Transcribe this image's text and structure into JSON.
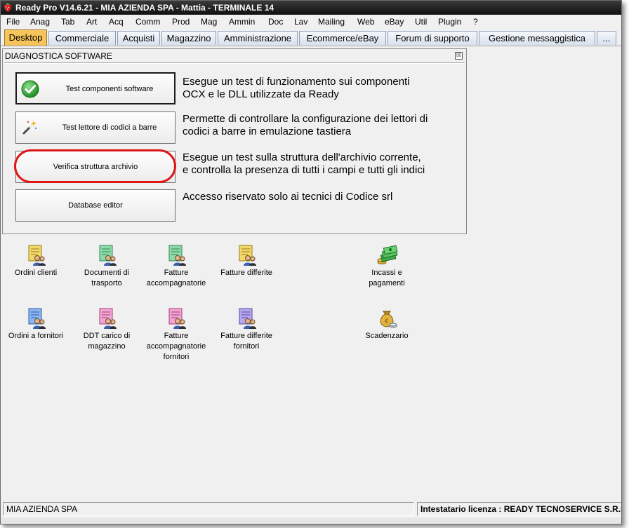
{
  "window": {
    "title": "Ready Pro V14.6.21 - MIA AZIENDA SPA - Mattia - TERMINALE 14"
  },
  "menu": {
    "items": [
      "File",
      "Anag",
      "Tab",
      "Art",
      "Acq",
      "Comm",
      "Prod",
      "Mag",
      "Ammin",
      "Doc",
      "Lav",
      "Mailing",
      "Web",
      "eBay",
      "Util",
      "Plugin",
      "?"
    ]
  },
  "tabs": {
    "items": [
      "Desktop",
      "Commerciale",
      "Acquisti",
      "Magazzino",
      "Amministrazione",
      "Ecommerce/eBay",
      "Forum di supporto",
      "Gestione messaggistica",
      "..."
    ],
    "active": "Desktop"
  },
  "diagnostic": {
    "title": "DIAGNOSTICA SOFTWARE",
    "close_glyph": "☒",
    "buttons": [
      {
        "label": "Test componenti software",
        "icon": "green-check-icon",
        "desc_line1": "Esegue un test di funzionamento sui componenti",
        "desc_line2": "OCX e le DLL utilizzate da Ready"
      },
      {
        "label": "Test lettore di codici a barre",
        "icon": "magic-wand-icon",
        "desc_line1": "Permette di controllare la configurazione dei lettori di",
        "desc_line2": "codici a barre in emulazione tastiera"
      },
      {
        "label": "Verifica struttura archivio",
        "icon": "",
        "desc_line1": "Esegue un test sulla struttura dell'archivio corrente,",
        "desc_line2": "e controlla la presenza di tutti i campi e tutti gli indici"
      },
      {
        "label": "Database editor",
        "icon": "",
        "desc_line1": "Accesso riservato solo ai tecnici di Codice srl",
        "desc_line2": ""
      }
    ]
  },
  "desktop": {
    "icons": [
      {
        "label": "Ordini clienti",
        "icon": "document-users-icon",
        "color": "#e8c840"
      },
      {
        "label": "Documenti di trasporto",
        "icon": "document-users-icon",
        "color": "#5cc08a"
      },
      {
        "label": "Fatture accompagnatorie",
        "icon": "document-users-icon",
        "color": "#5cc08a"
      },
      {
        "label": "Fatture differite",
        "icon": "document-users-icon",
        "color": "#e8c840"
      },
      {
        "label": "Incassi e pagamenti",
        "icon": "money-stack-icon",
        "color": "#2e9a3a"
      },
      {
        "label": "Ordini a fornitori",
        "icon": "document-users-icon",
        "color": "#4a82d8"
      },
      {
        "label": "DDT carico di magazzino",
        "icon": "document-users-icon",
        "color": "#e47ab8"
      },
      {
        "label": "Fatture accompagnatorie fornitori",
        "icon": "document-users-icon",
        "color": "#e47ab8"
      },
      {
        "label": "Fatture differite fornitori",
        "icon": "document-users-icon",
        "color": "#8c78d0"
      },
      {
        "label": "Scadenzario",
        "icon": "money-bag-icon",
        "color": "#d4a62a"
      }
    ]
  },
  "status": {
    "company": "MIA AZIENDA SPA",
    "license": "Intestatario licenza : READY TECNOSERVICE S.R.L."
  }
}
